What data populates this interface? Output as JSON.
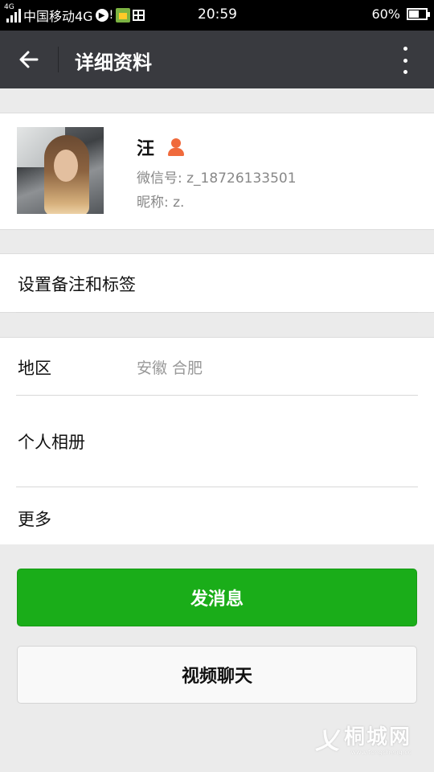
{
  "status_bar": {
    "network_badge": "4G",
    "carrier": "中国移动4G",
    "time": "20:59",
    "battery_percent": "60%",
    "battery_level": 0.6
  },
  "title_bar": {
    "title": "详细资料"
  },
  "profile": {
    "name": "汪",
    "wechat_id": "微信号: z_18726133501",
    "nickname": "昵称: z."
  },
  "remark_row": {
    "label": "设置备注和标签"
  },
  "info_rows": {
    "region_label": "地区",
    "region_value": "安徽  合肥",
    "album_label": "个人相册",
    "more_label": "更多"
  },
  "actions": {
    "send_message": "发消息",
    "video_chat": "视频聊天"
  },
  "watermark": {
    "text": "桐城网",
    "url": "www.tongcheng.cc"
  },
  "colors": {
    "primary_green": "#1aad19",
    "title_bar_bg": "#393a3f",
    "page_bg": "#ebebeb",
    "gender_icon": "#f06a3c"
  }
}
